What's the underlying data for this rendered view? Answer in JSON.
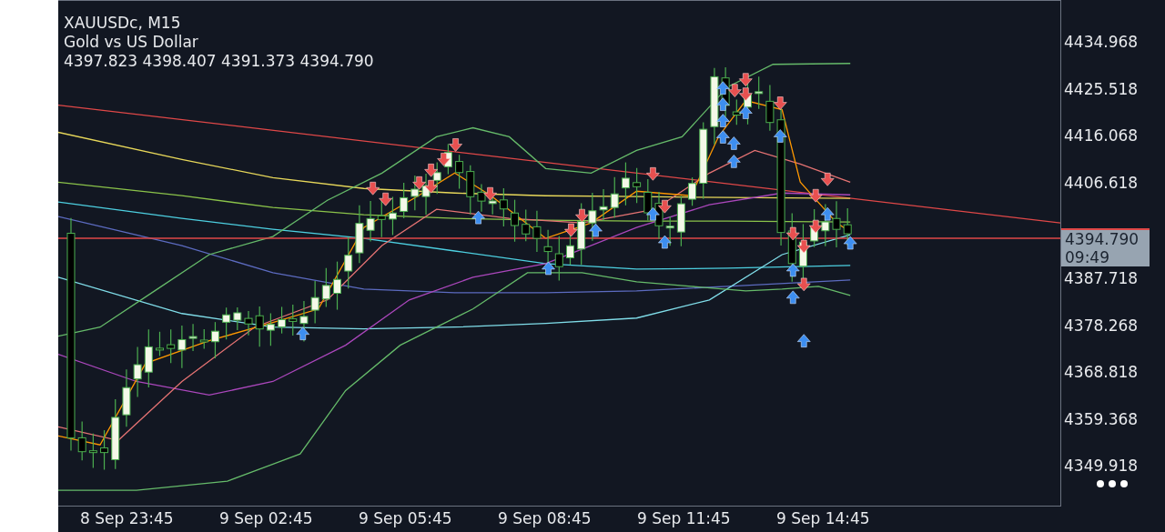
{
  "chart": {
    "symbol": "XAUUSDc, M15",
    "description": "Gold vs US Dollar",
    "ohlc": "4397.823 4398.407 4391.373 4394.790"
  },
  "price_axis": {
    "labels_above": [
      "4434.968",
      "4425.518",
      "4416.068",
      "4406.618"
    ],
    "current_price": "4394.790",
    "countdown": "09:49",
    "labels_below": [
      "4387.718",
      "4378.268",
      "4368.818",
      "4359.368",
      "4349.918"
    ]
  },
  "time_axis": {
    "labels": [
      "8 Sep 23:45",
      "9 Sep 02:45",
      "9 Sep 05:45",
      "9 Sep 08:45",
      "9 Sep 11:45",
      "9 Sep 14:45"
    ]
  }
}
